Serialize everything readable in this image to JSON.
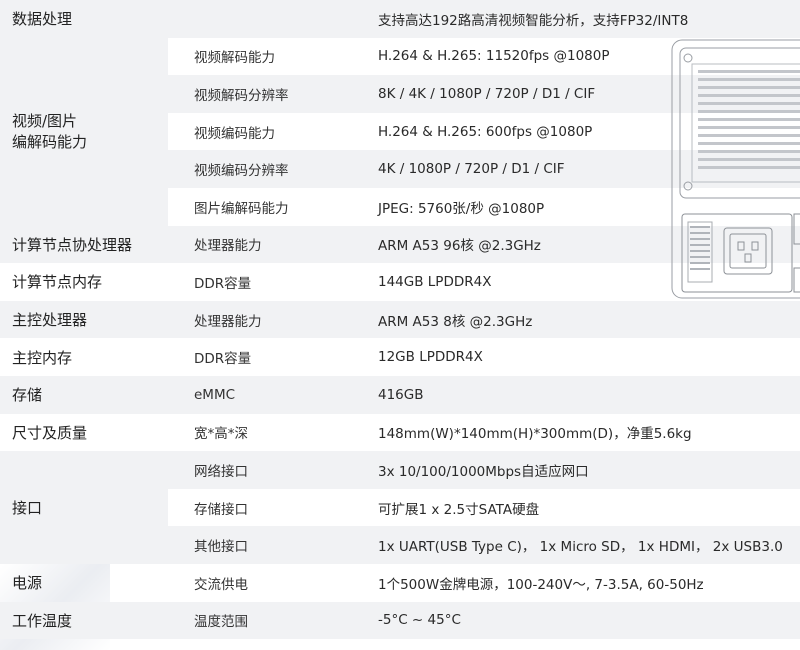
{
  "rows": [
    {
      "category": "数据处理",
      "sub": "",
      "value": "支持高达192路高清视频智能分析，支持FP32/INT8"
    },
    {
      "category": "视频/图片",
      "category2": "编解码能力",
      "sub": "视频解码能力",
      "value": "H.264 & H.265: 11520fps @1080P"
    },
    {
      "sub": "视频解码分辨率",
      "value": "8K / 4K / 1080P / 720P / D1 / CIF"
    },
    {
      "sub": "视频编码能力",
      "value": "H.264 & H.265: 600fps @1080P"
    },
    {
      "sub": "视频编码分辨率",
      "value": "4K / 1080P / 720P / D1 / CIF"
    },
    {
      "sub": "图片编解码能力",
      "value": "JPEG: 5760张/秒 @1080P"
    },
    {
      "category": "计算节点协处理器",
      "sub": "处理器能力",
      "value": "ARM A53 96核 @2.3GHz"
    },
    {
      "category": "计算节点内存",
      "sub": "DDR容量",
      "value": "144GB LPDDR4X"
    },
    {
      "category": "主控处理器",
      "sub": "处理器能力",
      "value": "ARM A53 8核 @2.3GHz"
    },
    {
      "category": "主控内存",
      "sub": "DDR容量",
      "value": "12GB LPDDR4X"
    },
    {
      "category": "存储",
      "sub": "eMMC",
      "value": "416GB"
    },
    {
      "category": "尺寸及质量",
      "sub": "宽*高*深",
      "value": "148mm(W)*140mm(H)*300mm(D)，净重5.6kg"
    },
    {
      "category": "接口",
      "sub": "网络接口",
      "value": "3x 10/100/1000Mbps自适应网口"
    },
    {
      "sub": "存储接口",
      "value": "可扩展1 x 2.5寸SATA硬盘"
    },
    {
      "sub": "其他接口",
      "value": "1x UART(USB Type C)， 1x Micro SD， 1x HDMI， 2x USB3.0"
    },
    {
      "category": "电源",
      "sub": "交流供电",
      "value": "1个500W金牌电源，100-240V～, 7-3.5A, 60-50Hz"
    },
    {
      "category": "工作温度",
      "sub": "温度范围",
      "value": "-5°C ~ 45°C"
    }
  ],
  "colors": {
    "shade": "#f1f2f4",
    "text": "#2b2b2b"
  },
  "icons": [
    "device-illustration"
  ]
}
